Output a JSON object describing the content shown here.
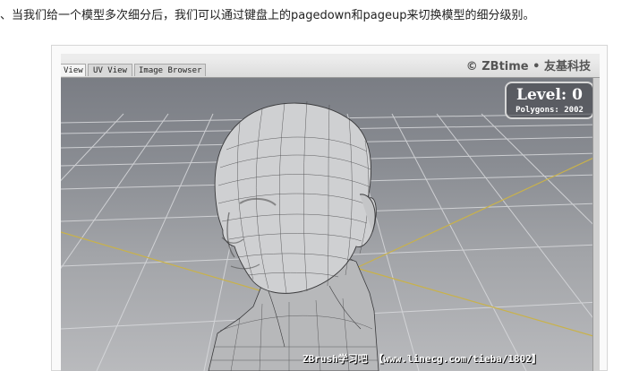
{
  "article": {
    "intro_text": "、当我们给一个模型多次细分后，我们可以通过键盘上的pagedown和pageup来切换模型的细分级别。"
  },
  "window": {
    "tabs": [
      {
        "label": "View",
        "active": true
      },
      {
        "label": "UV View",
        "active": false
      },
      {
        "label": "Image Browser",
        "active": false
      }
    ],
    "watermark_top": "© ZBtime • 友基科技"
  },
  "viewport": {
    "level_label": "Level: 0",
    "polygons_label": "Polygons: 2002",
    "watermark_bottom": "ZBrush学习吧 【www.linecg.com/tieba/1802】"
  },
  "colors": {
    "grid_line": "#d9dadd",
    "axis_line": "#c9b24a",
    "model_fill": "#cfd0d2",
    "model_wire": "#3a3a3c"
  },
  "icons": {
    "model": "head-bust-wireframe-model"
  }
}
